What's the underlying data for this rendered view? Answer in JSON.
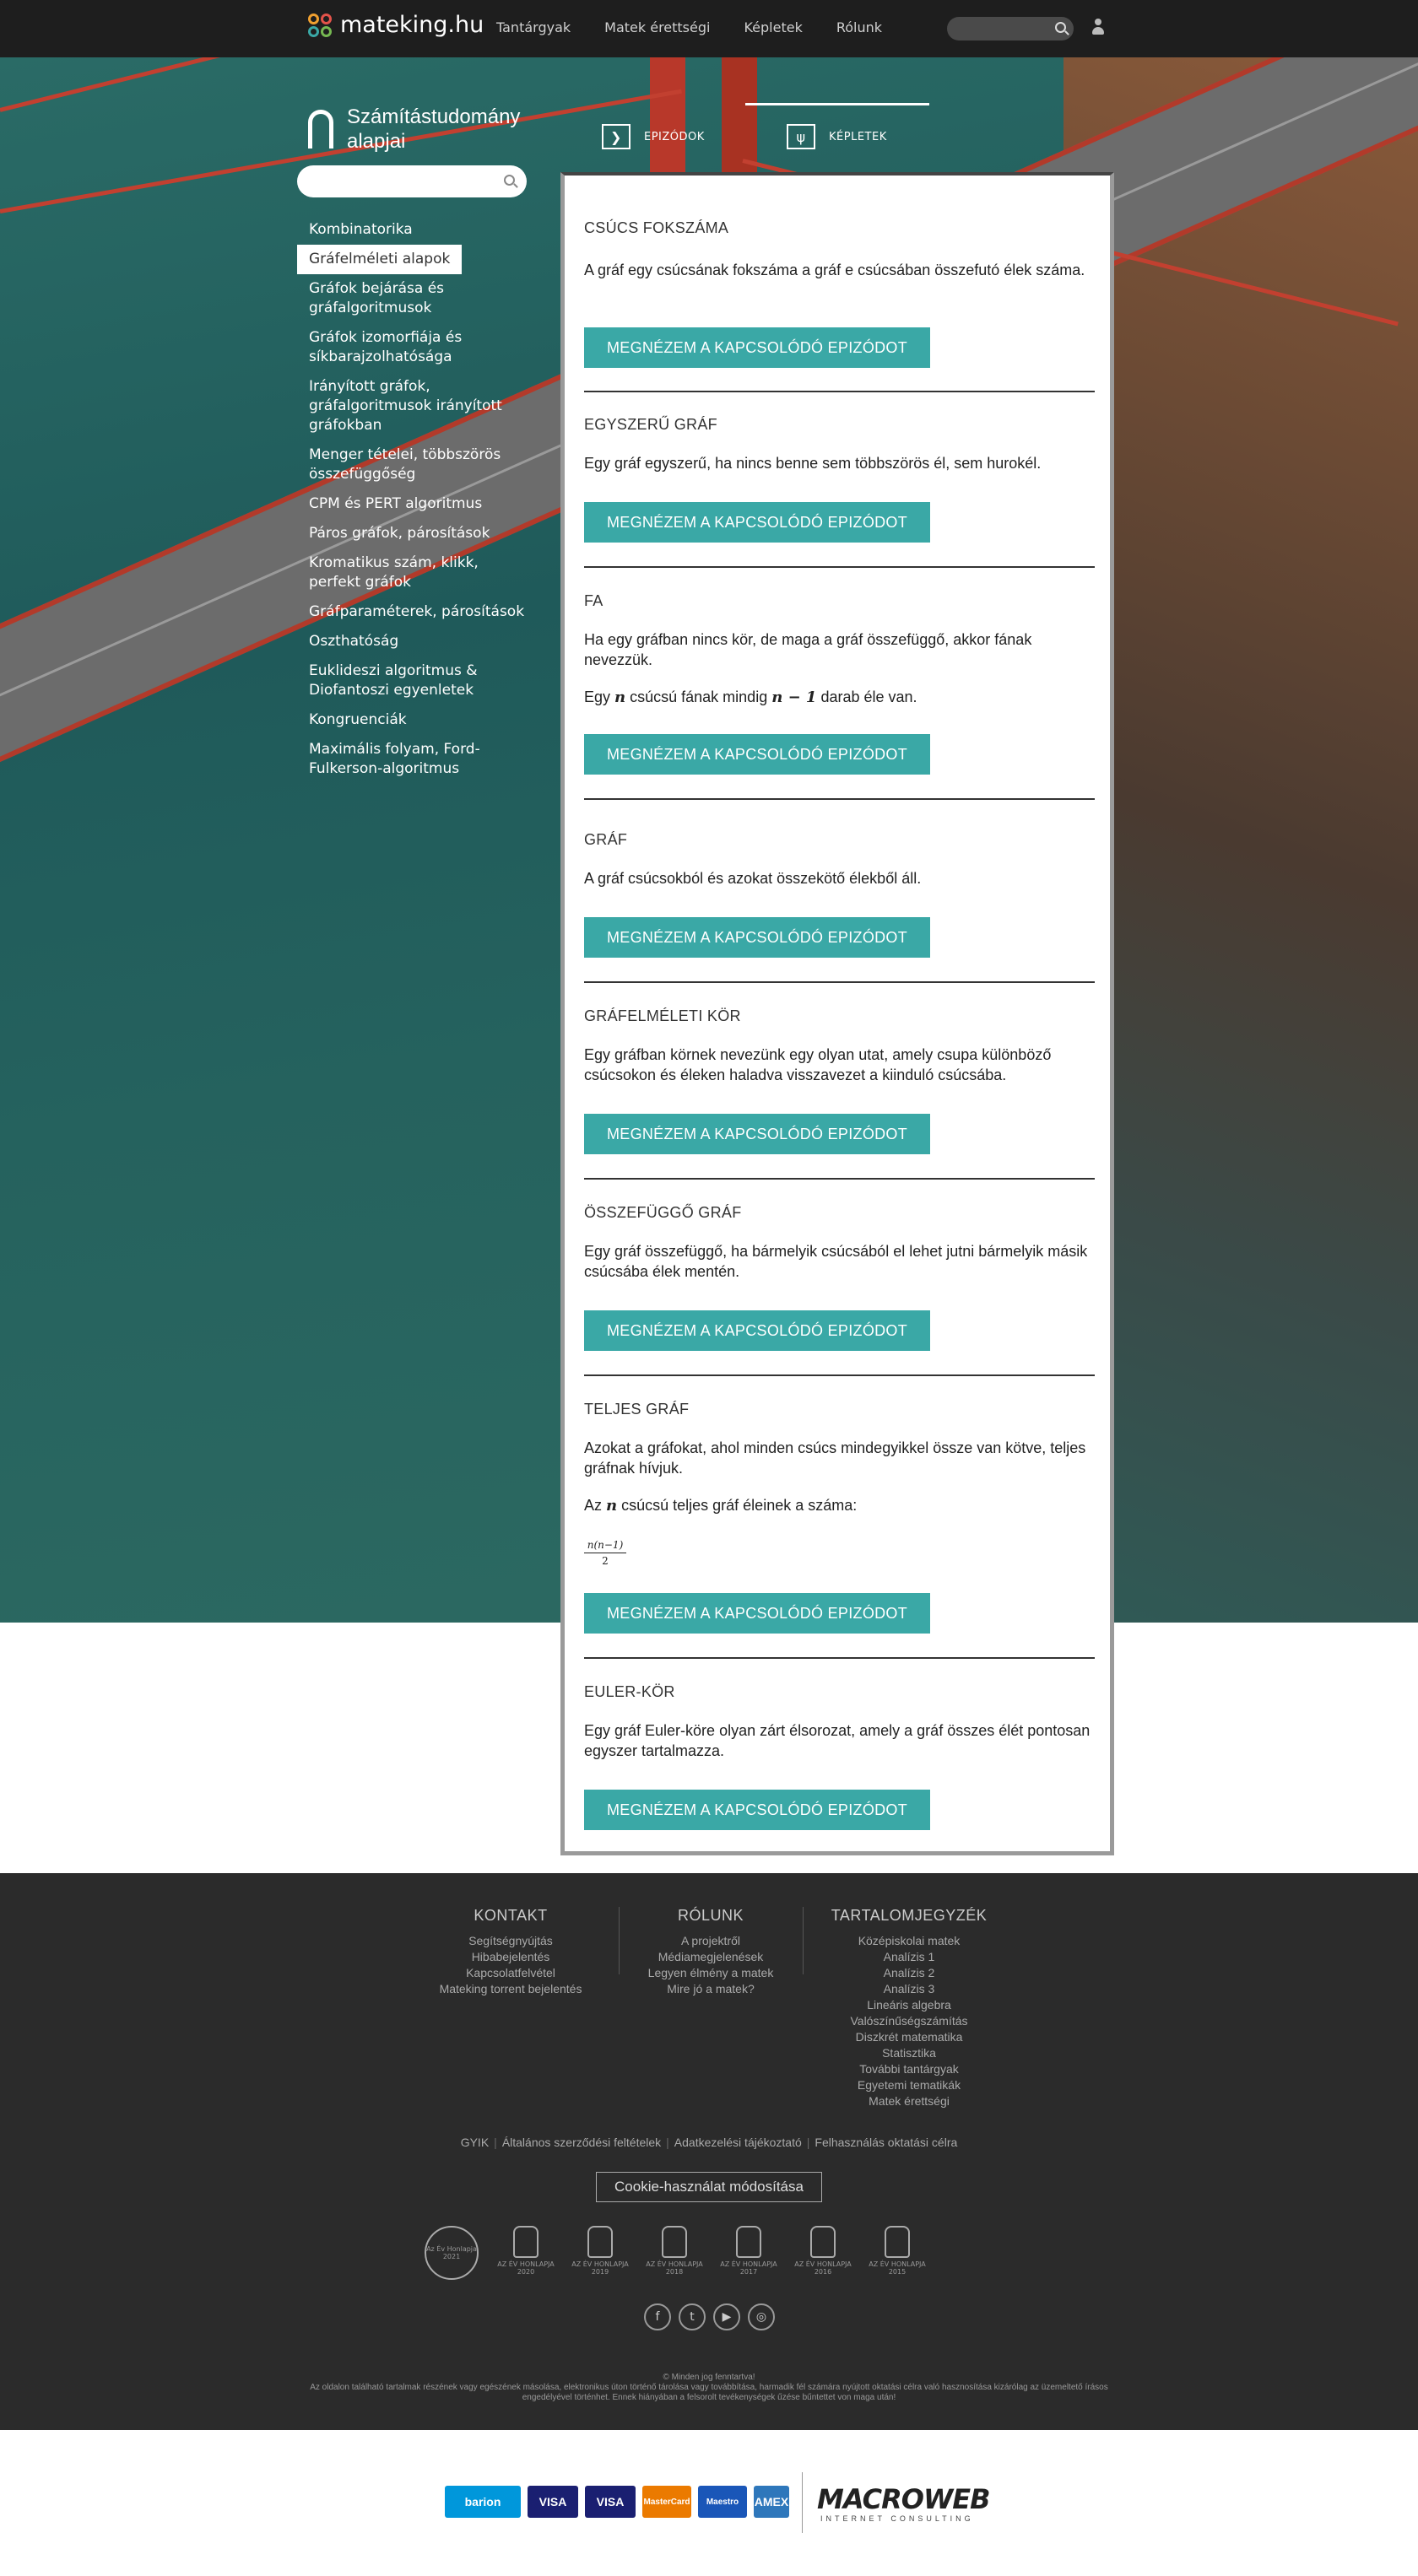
{
  "nav": {
    "logo": "mateking.hu",
    "links": [
      "Tantárgyak",
      "Matek érettségi",
      "Képletek",
      "Rólunk"
    ],
    "colors": [
      "#76b852",
      "#3aa8a6",
      "#3aa8a6",
      "#3aa8a6",
      "#3aa8a6",
      "#f0a030",
      "#f0a030",
      "#e3534a"
    ]
  },
  "sidebar": {
    "course_title": "Számítástudomány alapjai",
    "items": [
      {
        "label": "Kombinatorika"
      },
      {
        "label": "Gráfelméleti alapok"
      },
      {
        "label": "Gráfok bejárása és gráfalgoritmusok"
      },
      {
        "label": "Gráfok izomorfiája és síkbarajzolhatósága"
      },
      {
        "label": "Irányított gráfok, gráfalgoritmusok irányított gráfokban"
      },
      {
        "label": "Menger tételei, többszörös összefüggőség"
      },
      {
        "label": "CPM és PERT algoritmus"
      },
      {
        "label": "Páros gráfok, párosítások"
      },
      {
        "label": "Kromatikus szám, klikk, perfekt gráfok"
      },
      {
        "label": "Gráfparaméterek, párosítások"
      },
      {
        "label": "Oszthatóság"
      },
      {
        "label": "Euklideszi algoritmus & Diofantoszi egyenletek"
      },
      {
        "label": "Kongruenciák"
      },
      {
        "label": "Maximális folyam, Ford-Fulkerson-algoritmus"
      }
    ],
    "active_index": 1
  },
  "tabs": {
    "episodes": "EPIZÓDOK",
    "episodes_icon": "❯",
    "formulas": "KÉPLETEK",
    "formulas_icon": "ψ"
  },
  "button_label": "MEGNÉZEM A KAPCSOLÓDÓ EPIZÓDOT",
  "entries": [
    {
      "title": "CSÚCS FOKSZÁMA",
      "text": "A gráf egy csúcsának fokszáma a gráf e csúcsában összefutó élek száma."
    },
    {
      "title": "EGYSZERŰ GRÁF",
      "text": "Egy gráf egyszerű, ha nincs benne sem többszörös él, sem hurokél."
    },
    {
      "title": "FA",
      "text": "Ha egy gráfban nincs kör, de maga a gráf összefüggő, akkor fának nevezzük.",
      "text2_pre": "Egy ",
      "text2_var": "n",
      "text2_mid": " csúcsú fának mindig ",
      "text2_formula": "n − 1",
      "text2_post": " darab éle van."
    },
    {
      "title": "GRÁF",
      "text": "A gráf csúcsokból és azokat összekötő élekből áll."
    },
    {
      "title": "GRÁFELMÉLETI KÖR",
      "text": "Egy gráfban körnek nevezünk egy olyan utat, amely csupa különböző csúcsokon és éleken haladva visszavezet a kiinduló csúcsába."
    },
    {
      "title": "ÖSSZEFÜGGŐ GRÁF",
      "text": "Egy gráf összefüggő, ha bármelyik csúcsából el lehet jutni bármelyik másik csúcsába élek mentén."
    },
    {
      "title": "TELJES GRÁF",
      "text": "Azokat a gráfokat, ahol minden csúcs mindegyikkel össze van kötve, teljes gráfnak hívjuk.",
      "text2_pre": "Az ",
      "text2_var": "n",
      "text2_post": " csúcsú teljes gráf éleinek a száma:",
      "frac_num": "n(n−1)",
      "frac_den": "2"
    },
    {
      "title": "EULER-KÖR",
      "text": "Egy gráf Euler-köre olyan zárt élsorozat, amely a gráf összes élét pontosan egyszer tartalmazza."
    }
  ],
  "footer": {
    "kontakt": {
      "title": "KONTAKT",
      "items": [
        "Segítségnyújtás",
        "Hibabejelentés",
        "Kapcsolatfelvétel",
        "Mateking torrent bejelentés"
      ]
    },
    "rolunk": {
      "title": "RÓLUNK",
      "items": [
        "A projektről",
        "Médiamegjelenések",
        "Legyen élmény a matek",
        "Mire jó a matek?"
      ]
    },
    "tartalom": {
      "title": "TARTALOMJEGYZÉK",
      "items": [
        "Középiskolai matek",
        "Analízis 1",
        "Analízis 2",
        "Analízis 3",
        "Lineáris algebra",
        "Valószínűségszámítás",
        "Diszkrét matematika",
        "Statisztika",
        "További tantárgyak",
        "Egyetemi tematikák",
        "Matek érettségi"
      ]
    },
    "legal": [
      "GYIK",
      "Általános szerződési feltételek",
      "Adatkezelési tájékoztató",
      "Felhasználás oktatási célra"
    ],
    "cookie": "Cookie-használat módosítása",
    "awards": [
      {
        "label": "Az Év Honlapja 2021"
      },
      {
        "label": "AZ ÉV HONLAPJA 2020"
      },
      {
        "label": "AZ ÉV HONLAPJA 2019"
      },
      {
        "label": "AZ ÉV HONLAPJA 2018"
      },
      {
        "label": "AZ ÉV HONLAPJA 2017"
      },
      {
        "label": "AZ ÉV HONLAPJA 2016"
      },
      {
        "label": "AZ ÉV HONLAPJA 2015"
      }
    ],
    "social": [
      {
        "icon": "facebook-icon",
        "glyph": "f"
      },
      {
        "icon": "twitter-icon",
        "glyph": "t"
      },
      {
        "icon": "youtube-icon",
        "glyph": "▶"
      },
      {
        "icon": "instagram-icon",
        "glyph": "◎"
      }
    ],
    "copyright": "© Minden jog fenntartva!",
    "disclaimer": "Az oldalon található tartalmak részének vagy egészének másolása, elektronikus úton történő tárolása vagy továbbítása, harmadik fél számára nyújtott oktatási célra való hasznosítása kizárólag az üzemeltető írásos engedélyével történhet. Ennek hiányában a felsorolt tevékenységek űzése bűntettet von maga után!"
  },
  "payments": {
    "cards": [
      {
        "label": "barion",
        "color": "#0097db"
      },
      {
        "label": "VISA",
        "color": "#1a1f71"
      },
      {
        "label": "VISA",
        "color": "#1a1f71"
      },
      {
        "label": "MasterCard",
        "color": "#eb7a00"
      },
      {
        "label": "Maestro",
        "color": "#1a56b8"
      },
      {
        "label": "AMEX",
        "color": "#2e77bb"
      }
    ],
    "macroweb": "MACROWEB",
    "macroweb_sub": "INTERNET CONSULTING"
  }
}
